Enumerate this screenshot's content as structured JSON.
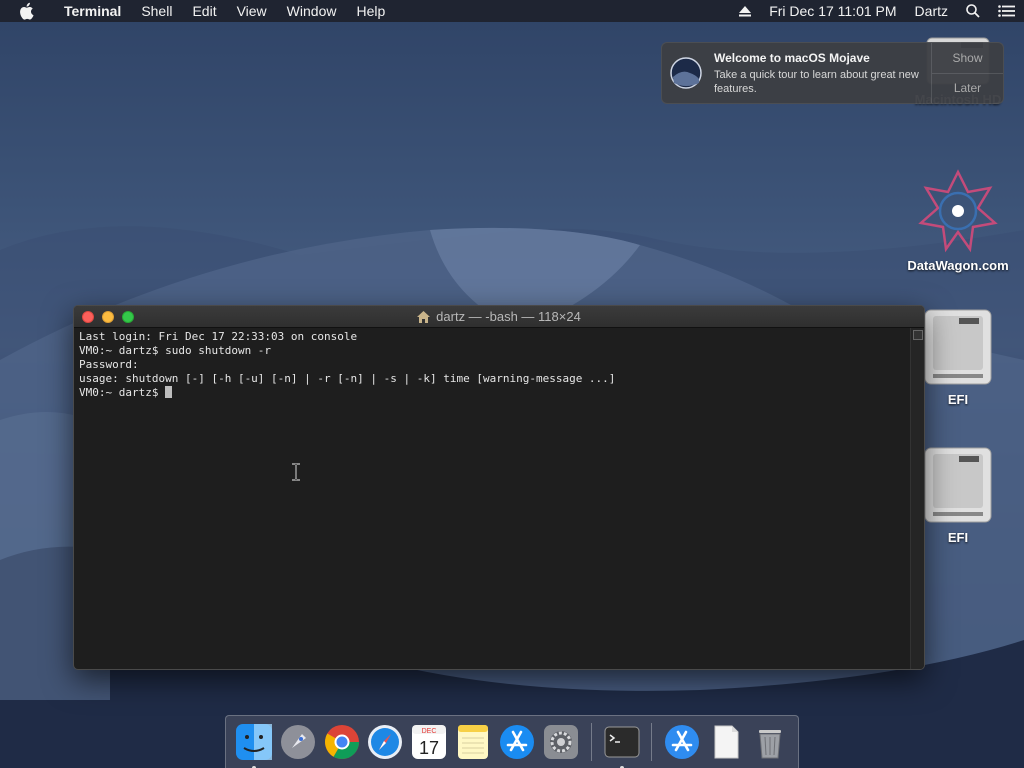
{
  "menubar": {
    "app_name": "Terminal",
    "menus": [
      "Shell",
      "Edit",
      "View",
      "Window",
      "Help"
    ],
    "datetime": "Fri Dec 17  11:01 PM",
    "user": "Dartz"
  },
  "notification": {
    "title": "Welcome to macOS Mojave",
    "text": "Take a quick tour to learn about great new features.",
    "show_label": "Show",
    "later_label": "Later"
  },
  "desktop_icons": [
    {
      "label": "Macintosh HD",
      "icon": "hard-drive-icon"
    },
    {
      "label": "DataWagon.com",
      "icon": "datawagon-logo-icon"
    },
    {
      "label": "EFI",
      "icon": "hard-drive-icon"
    },
    {
      "label": "EFI",
      "icon": "hard-drive-icon"
    }
  ],
  "terminal": {
    "title": "dartz — -bash — 118×24",
    "lines": [
      "Last login: Fri Dec 17 22:33:03 on console",
      "VM0:~ dartz$ sudo shutdown -r",
      "Password:",
      "usage: shutdown [-] [-h [-u] [-n] | -r [-n] | -s | -k] time [warning-message ...]",
      "VM0:~ dartz$ "
    ]
  },
  "dock": {
    "items": [
      "finder",
      "launchpad",
      "chrome",
      "safari",
      "calendar",
      "notes",
      "app-store",
      "system-preferences",
      "terminal",
      "downloads",
      "documents",
      "trash"
    ],
    "calendar_month": "DEC",
    "calendar_day": "17"
  },
  "colors": {
    "menubar_bg": "#1e222c",
    "terminal_bg": "#1e1e1e",
    "traffic_red": "#fc605b",
    "traffic_yellow": "#fdbc40",
    "traffic_green": "#34c84a"
  }
}
